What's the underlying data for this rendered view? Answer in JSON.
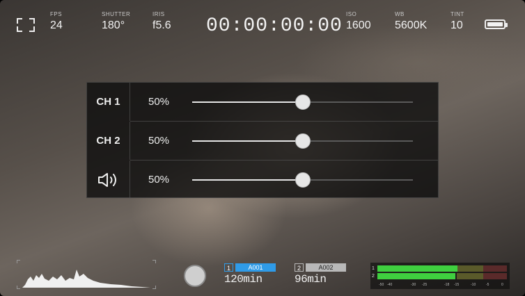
{
  "top_bar": {
    "fps": {
      "label": "FPS",
      "value": "24"
    },
    "shutter": {
      "label": "SHUTTER",
      "value": "180°"
    },
    "iris": {
      "label": "IRIS",
      "value": "f5.6"
    },
    "timecode": "00:00:00:00",
    "iso": {
      "label": "ISO",
      "value": "1600"
    },
    "wb": {
      "label": "WB",
      "value": "5600K"
    },
    "tint": {
      "label": "TINT",
      "value": "10"
    },
    "battery_level": 1.0
  },
  "audio_panel": {
    "rows": [
      {
        "name": "CH 1",
        "percent_label": "50%",
        "level": 0.5
      },
      {
        "name": "CH 2",
        "percent_label": "50%",
        "level": 0.5
      },
      {
        "name": "",
        "icon": "speaker-volume-icon",
        "percent_label": "50%",
        "level": 0.5
      }
    ]
  },
  "bottom_bar": {
    "cards": [
      {
        "number": "1",
        "clip": "A001",
        "remaining": "120min",
        "active": true,
        "color": "#2f9be8"
      },
      {
        "number": "2",
        "clip": "A002",
        "remaining": "96min",
        "active": false,
        "color": "#b8b8b8"
      }
    ],
    "audio_meter": {
      "channels": [
        {
          "number": "1",
          "level": 0.62
        },
        {
          "number": "2",
          "level": 0.6
        }
      ],
      "scale": [
        "-50",
        "-40",
        "-30",
        "-25",
        "-18",
        "-15",
        "-10",
        "-5",
        "0"
      ]
    }
  },
  "colors": {
    "accent_blue": "#2f9be8",
    "meter_green": "#3fcf3f",
    "meter_yellow": "#5a5a2a",
    "meter_red": "#5a2a2a"
  }
}
